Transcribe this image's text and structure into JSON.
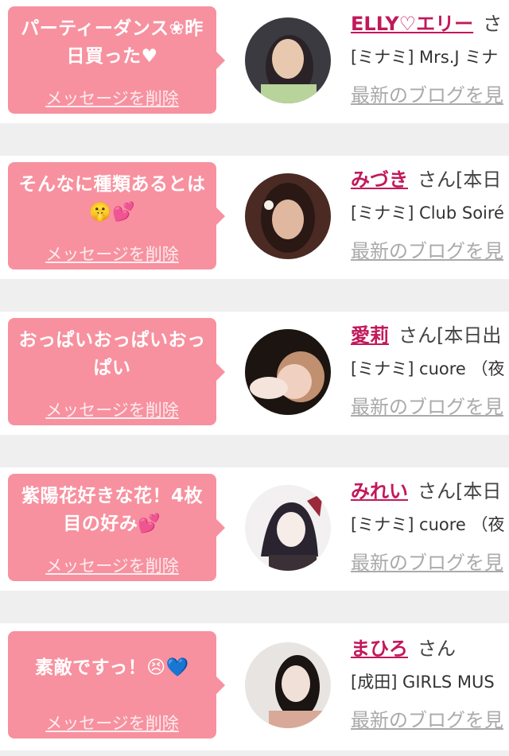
{
  "entries": [
    {
      "message": "パーティーダンス❀昨日買った♥",
      "delete_label": "メッセージを削除",
      "name": "ELLY♡エリー",
      "suffix": "さ",
      "shop": "[ミナミ] Mrs.J ミナ",
      "blog_label": "最新のブログを見",
      "avatar_colors": [
        "#3a3a40",
        "#e8c9b0",
        "#8a6a52"
      ]
    },
    {
      "message": "そんなに種類あるとは🤫💕",
      "delete_label": "メッセージを削除",
      "name": "みづき",
      "suffix": "さん[本日",
      "shop": "[ミナミ] Club Soiré",
      "blog_label": "最新のブログを見",
      "avatar_colors": [
        "#2a1814",
        "#e0b8a0",
        "#5a3024"
      ]
    },
    {
      "message": "おっぱいおっぱいおっぱい",
      "delete_label": "メッセージを削除",
      "name": "愛莉",
      "suffix": "さん[本日出",
      "shop": "[ミナミ] cuore （夜",
      "blog_label": "最新のブログを見",
      "avatar_colors": [
        "#1c1410",
        "#f0d0c0",
        "#c09070"
      ]
    },
    {
      "message": "紫陽花好きな花！4枚目の好み💕",
      "delete_label": "メッセージを削除",
      "name": "みれい",
      "suffix": "さん[本日",
      "shop": "[ミナミ] cuore （夜",
      "blog_label": "最新のブログを見",
      "avatar_colors": [
        "#f2f0f0",
        "#2a2430",
        "#9a2a3a"
      ]
    },
    {
      "message": "素敵ですっ！😣💙",
      "delete_label": "メッセージを削除",
      "name": "まひろ",
      "suffix": "さん",
      "shop": "[成田] GIRLS MUS",
      "blog_label": "最新のブログを見",
      "avatar_colors": [
        "#e8e4e2",
        "#1a1412",
        "#d8a898"
      ]
    }
  ]
}
